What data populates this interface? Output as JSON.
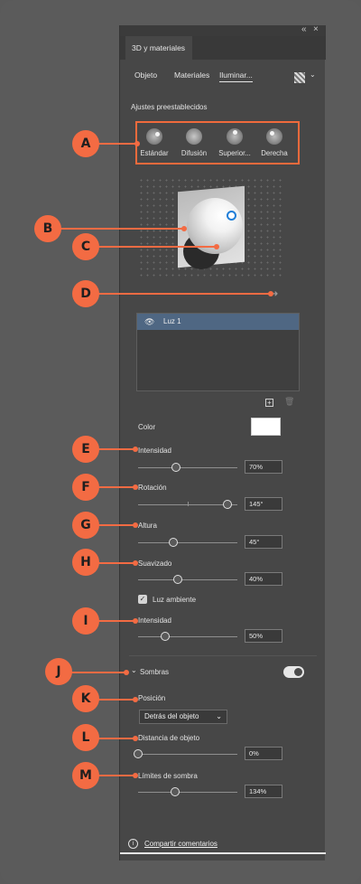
{
  "panel": {
    "tab_title": "3D y materiales",
    "tabs": [
      "Objeto",
      "Materiales",
      "Iluminar..."
    ],
    "presets_label": "Ajustes preestablecidos",
    "presets": [
      "Estándar",
      "Difusión",
      "Superior...",
      "Derecha"
    ],
    "lights_list": [
      "Luz 1"
    ],
    "color_label": "Color",
    "light_color": "#ffffff",
    "intensity_label": "Intensidad",
    "intensity_value": "70%",
    "rotation_label": "Rotación",
    "rotation_value": "145°",
    "height_label": "Altura",
    "height_value": "45°",
    "softness_label": "Suavizado",
    "softness_value": "40%",
    "ambient_label": "Luz ambiente",
    "ambient_intensity_label": "Intensidad",
    "ambient_intensity_value": "50%",
    "shadows_label": "Sombras",
    "position_label": "Posición",
    "position_value": "Detrás del objeto",
    "distance_label": "Distancia de objeto",
    "distance_value": "0%",
    "shadow_bounds_label": "Límites de sombra",
    "shadow_bounds_value": "134%",
    "feedback_label": "Compartir comentarios"
  },
  "callouts": [
    "A",
    "B",
    "C",
    "D",
    "E",
    "F",
    "G",
    "H",
    "I",
    "J",
    "K",
    "L",
    "M"
  ],
  "colors": {
    "accent": "#f36b43",
    "panel": "#474747",
    "selected_row": "#4f6783"
  },
  "icons": [
    "collapse-icon",
    "close-icon",
    "texture-icon",
    "eye-icon",
    "add-icon",
    "trash-icon",
    "info-icon",
    "chevron-down-icon",
    "arrow-icon"
  ]
}
